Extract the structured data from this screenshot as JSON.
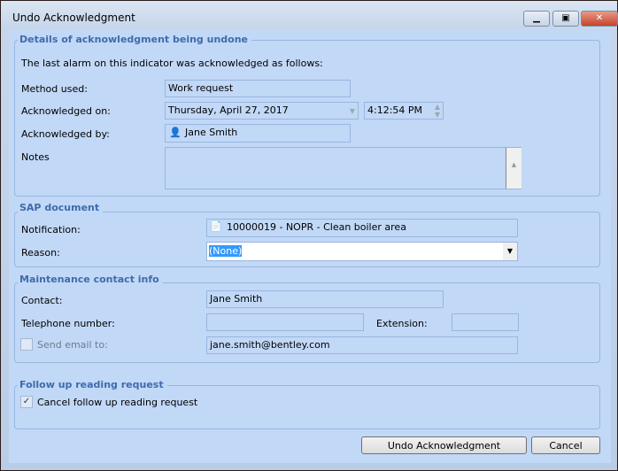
{
  "window": {
    "title": "Undo Acknowledgment",
    "icons": [
      "minimize-icon",
      "maximize-icon",
      "close-icon"
    ]
  },
  "details": {
    "legend": "Details of acknowledgment being undone",
    "intro": "The last alarm on this indicator was acknowledged as follows:",
    "method_label": "Method used:",
    "method_value": "Work request",
    "ack_on_label": "Acknowledged on:",
    "date_value": "Thursday, April 27, 2017",
    "time_value": "4:12:54 PM",
    "ack_by_label": "Acknowledged by:",
    "ack_by_value": "Jane Smith",
    "notes_label": "Notes",
    "notes_value": ""
  },
  "sap": {
    "legend": "SAP document",
    "notification_label": "Notification:",
    "notification_value": "10000019 - NOPR - Clean boiler area",
    "reason_label": "Reason:",
    "reason_value": "(None)"
  },
  "contact": {
    "legend": "Maintenance contact info",
    "contact_label": "Contact:",
    "contact_value": "Jane Smith",
    "phone_label": "Telephone number:",
    "phone_value": "",
    "ext_label": "Extension:",
    "ext_value": "",
    "email_label": "Send email to:",
    "email_checked": false,
    "email_value": "jane.smith@bentley.com"
  },
  "followup": {
    "legend": "Follow up reading request",
    "cancel_label": "Cancel follow up reading request",
    "cancel_checked": true
  },
  "buttons": {
    "undo": "Undo Acknowledgment",
    "cancel": "Cancel"
  }
}
